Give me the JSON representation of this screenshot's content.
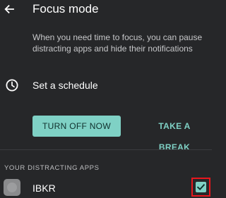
{
  "header": {
    "title": "Focus mode",
    "back_icon": "arrow-back-icon"
  },
  "description": "When you need time to focus, you can pause distracting apps and hide their notifications",
  "schedule": {
    "icon": "clock-icon",
    "label": "Set a schedule"
  },
  "actions": {
    "turn_off_label": "TURN OFF NOW",
    "take_break_label": "TAKE A BREAK"
  },
  "apps_section": {
    "header": "YOUR DISTRACTING APPS",
    "apps": [
      {
        "name": "IBKR",
        "icon": "app-icon",
        "checked": true
      }
    ]
  },
  "colors": {
    "background": "#262729",
    "accent": "#7fd1c5",
    "highlight": "#e8171d"
  }
}
